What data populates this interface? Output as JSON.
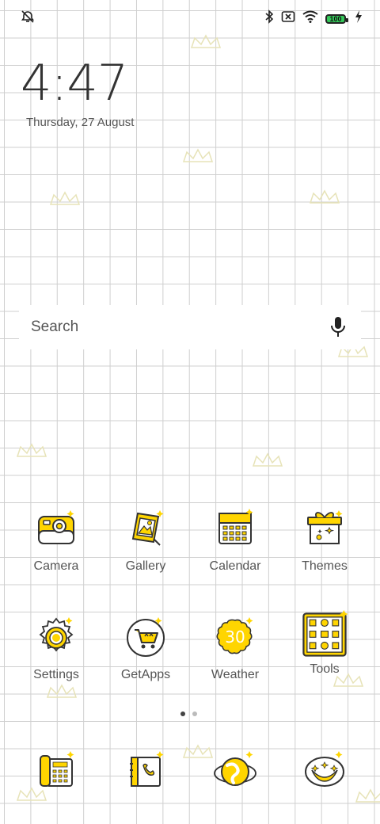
{
  "status_bar": {
    "left_icon": "alarm-off-icon",
    "right_icons": [
      "bluetooth-icon",
      "no-sim-icon",
      "wifi-icon",
      "battery-icon",
      "charging-icon"
    ],
    "battery_level": "100",
    "battery_color": "#34c759"
  },
  "clock": {
    "time": "4:47",
    "date": "Thursday, 27 August"
  },
  "search": {
    "placeholder": "Search",
    "mic_icon": "microphone-icon"
  },
  "apps": [
    {
      "label": "Camera",
      "icon": "camera-icon"
    },
    {
      "label": "Gallery",
      "icon": "gallery-icon"
    },
    {
      "label": "Calendar",
      "icon": "calendar-icon"
    },
    {
      "label": "Themes",
      "icon": "themes-gift-icon"
    },
    {
      "label": "Settings",
      "icon": "settings-gear-icon"
    },
    {
      "label": "GetApps",
      "icon": "getapps-cart-icon"
    },
    {
      "label": "Weather",
      "icon": "weather-icon",
      "badge": "30"
    },
    {
      "label": "Tools",
      "icon": "tools-folder-icon"
    }
  ],
  "page_indicator": {
    "count": 2,
    "active": 1
  },
  "dock": [
    {
      "icon": "phone-icon"
    },
    {
      "icon": "contacts-icon"
    },
    {
      "icon": "browser-icon"
    },
    {
      "icon": "messages-icon"
    }
  ],
  "colors": {
    "accent_yellow": "#ffd500",
    "outline": "#333333",
    "grid": "#cfcfcf",
    "dot_active": "#444444",
    "dot_inactive": "#bbbbbb"
  }
}
